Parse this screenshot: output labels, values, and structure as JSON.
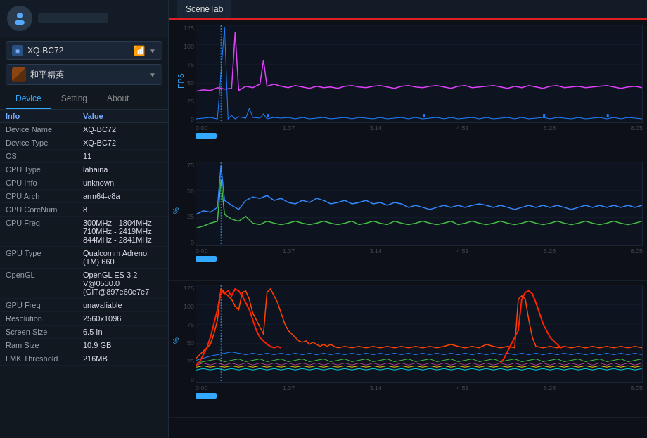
{
  "sidebar": {
    "profile": {
      "avatar_alt": "user avatar"
    },
    "device_selector": {
      "label": "XQ-BC72",
      "wifi_icon": "📶",
      "arrow": "▼"
    },
    "game_selector": {
      "label": "和平精英",
      "arrow": "▼"
    },
    "tabs": [
      {
        "id": "device",
        "label": "Device",
        "active": true
      },
      {
        "id": "setting",
        "label": "Setting",
        "active": false
      },
      {
        "id": "about",
        "label": "About",
        "active": false
      }
    ],
    "info_header": {
      "key_col": "Info",
      "val_col": "Value"
    },
    "info_rows": [
      {
        "key": "Device Name",
        "val": "XQ-BC72"
      },
      {
        "key": "Device Type",
        "val": "XQ-BC72"
      },
      {
        "key": "OS",
        "val": "11"
      },
      {
        "key": "CPU Type",
        "val": "lahaina"
      },
      {
        "key": "CPU Info",
        "val": "unknown"
      },
      {
        "key": "CPU Arch",
        "val": "arm64-v8a"
      },
      {
        "key": "CPU CoreNum",
        "val": "8"
      },
      {
        "key": "CPU Freq",
        "val": "300MHz - 1804MHz\n710MHz - 2419MHz\n844MHz - 2841MHz"
      },
      {
        "key": "GPU Type",
        "val": "Qualcomm Adreno (TM) 660"
      },
      {
        "key": "OpenGL",
        "val": "OpenGL ES 3.2 V@0530.0 (GIT@897e60e7e7"
      },
      {
        "key": "GPU Freq",
        "val": "unavaliable"
      },
      {
        "key": "Resolution",
        "val": "2560x1096"
      },
      {
        "key": "Screen Size",
        "val": "6.5 In"
      },
      {
        "key": "Ram Size",
        "val": "10.9 GB"
      },
      {
        "key": "LMK Threshold",
        "val": "216MB"
      }
    ]
  },
  "main": {
    "scene_tab_label": "SceneTab",
    "charts": [
      {
        "id": "fps-chart",
        "y_label": "FPS",
        "y_max": 125,
        "y_ticks": [
          "125",
          "100",
          "75",
          "50",
          "25",
          "0"
        ],
        "time_labels": [
          "0:00",
          "1:37",
          "3:14",
          "4:51",
          "6:28",
          "8:05"
        ]
      },
      {
        "id": "cpu-chart",
        "y_label": "%",
        "y_max": 75,
        "y_ticks": [
          "75",
          "50",
          "25",
          "0"
        ],
        "time_labels": [
          "0:00",
          "1:37",
          "3:14",
          "4:51",
          "6:28",
          "8:05"
        ]
      },
      {
        "id": "mem-chart",
        "y_label": "%",
        "y_max": 125,
        "y_ticks": [
          "125",
          "100",
          "75",
          "50",
          "25",
          "0"
        ],
        "time_labels": [
          "0:00",
          "1:37",
          "3:14",
          "4:51",
          "6:28",
          "8:05"
        ]
      }
    ]
  }
}
